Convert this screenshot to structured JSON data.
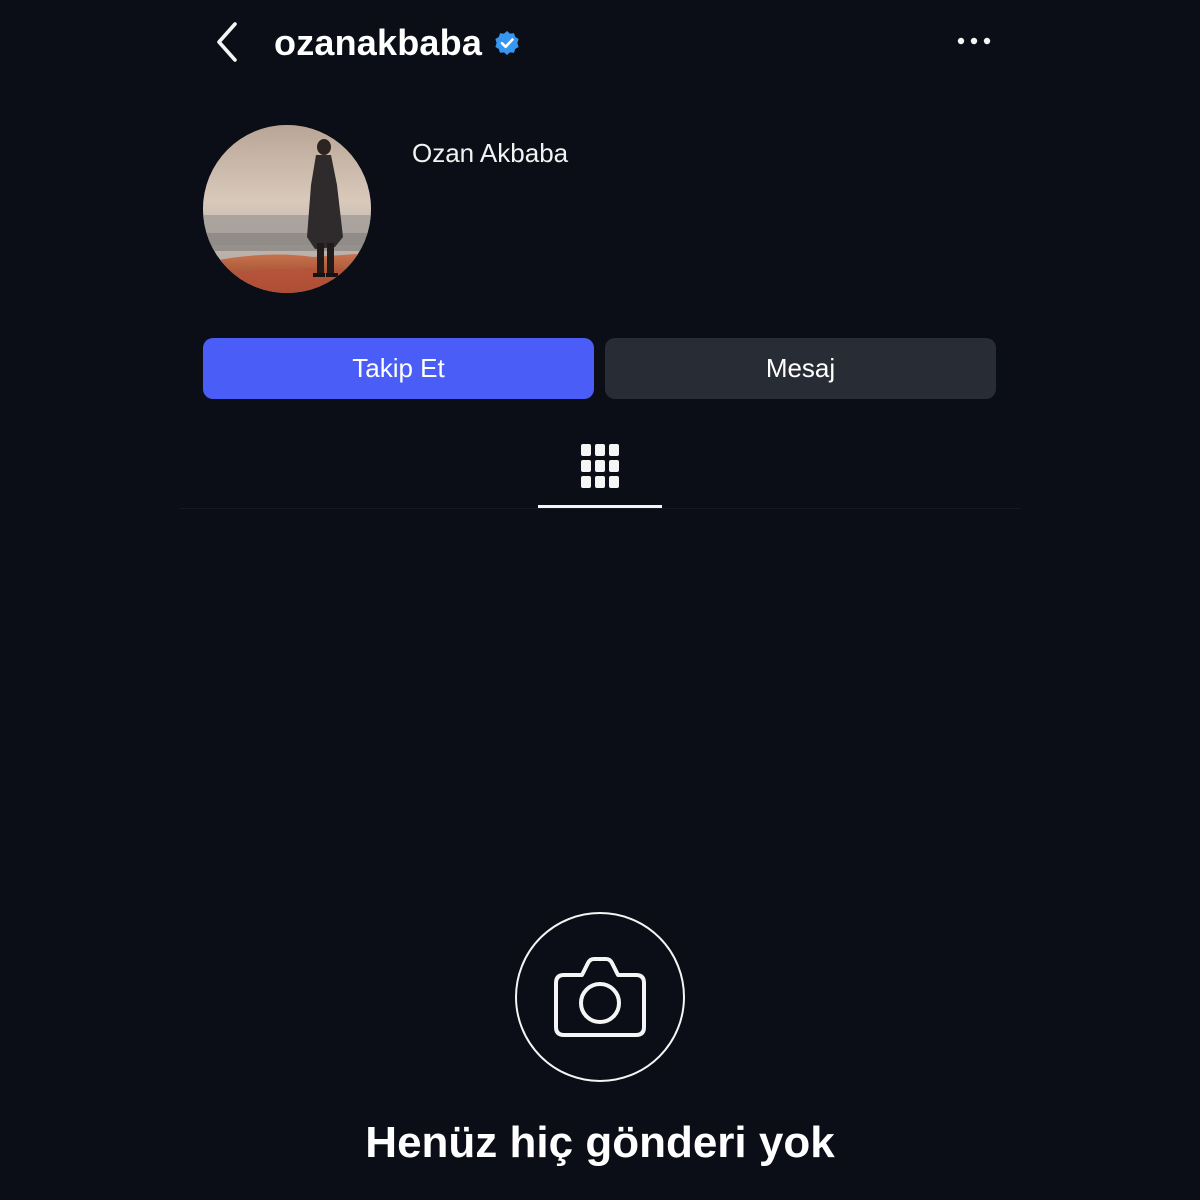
{
  "header": {
    "username": "ozanakbaba",
    "verified_icon": "verified-badge-icon",
    "back_icon": "chevron-left-icon",
    "more_icon": "more-horizontal-icon"
  },
  "profile": {
    "display_name": "Ozan Akbaba",
    "avatar_icon": "profile-avatar"
  },
  "actions": {
    "follow_label": "Takip Et",
    "message_label": "Mesaj"
  },
  "tabs": {
    "grid_icon": "grid-icon"
  },
  "empty_state": {
    "icon": "camera-icon",
    "title": "Henüz hiç gönderi yok"
  },
  "colors": {
    "background": "#0b0e16",
    "follow_button": "#4a5ef7",
    "message_button": "#282c34",
    "verified": "#3797f0"
  }
}
